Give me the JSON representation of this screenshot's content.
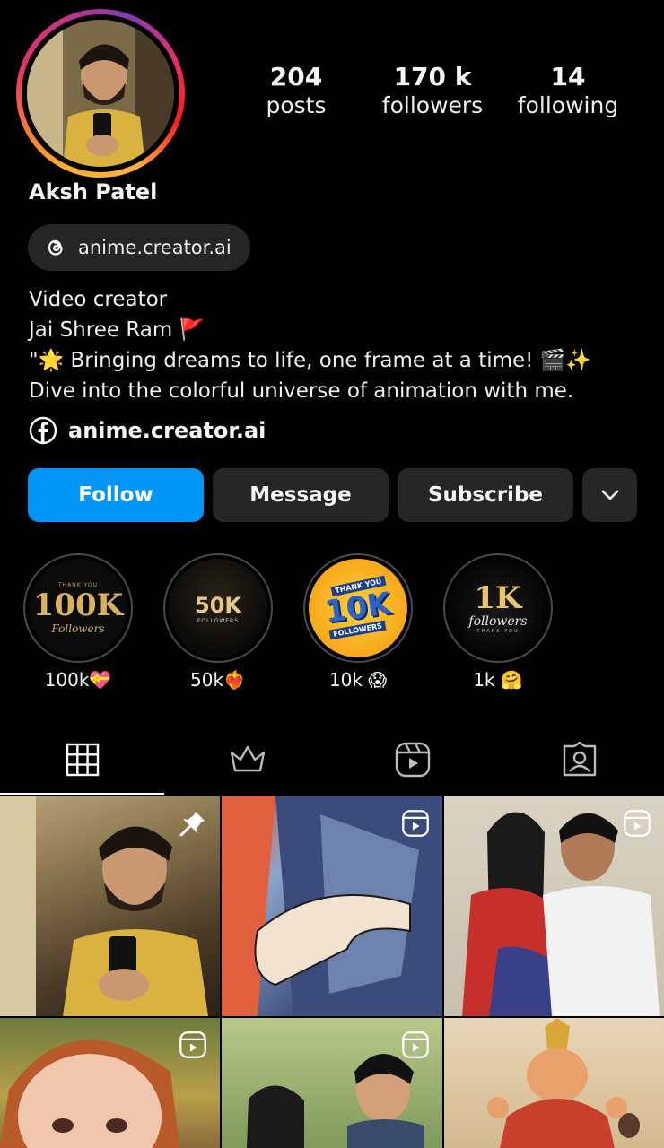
{
  "profile": {
    "name": "Aksh Patel",
    "threads_handle": "anime.creator.ai",
    "facebook_link": "anime.creator.ai"
  },
  "stats": [
    {
      "value": "204",
      "label": "posts"
    },
    {
      "value": "170 k",
      "label": "followers"
    },
    {
      "value": "14",
      "label": "following"
    }
  ],
  "bio": {
    "line1": "Video creator",
    "line2": "Jai Shree Ram 🚩",
    "line3": "\"🌟 Bringing dreams to life, one frame at a time! 🎬✨",
    "line4": "Dive into the colorful universe of animation with me."
  },
  "actions": {
    "follow": "Follow",
    "message": "Message",
    "subscribe": "Subscribe"
  },
  "highlights": [
    {
      "label": "100k💝",
      "badge_big": "100K",
      "badge_small": "Followers",
      "badge_top": "THANK YOU"
    },
    {
      "label": "50k❤️‍🔥",
      "badge_big": "50K",
      "badge_small": "FOLLOWERS"
    },
    {
      "label": "10k 😱",
      "badge_big": "10K",
      "badge_small": "FOLLOWERS",
      "badge_top": "THANK YOU"
    },
    {
      "label": "1k 🤗",
      "badge_big": "1K",
      "badge_small": "followers",
      "badge_top": "THANK YOU"
    }
  ],
  "tabs": [
    "grid-icon",
    "crown-icon",
    "reels-icon",
    "tagged-icon"
  ],
  "colors": {
    "accent": "#0095f6",
    "button_bg": "#262626",
    "background": "#000000"
  },
  "grid": [
    {
      "type": "pinned"
    },
    {
      "type": "reel"
    },
    {
      "type": "reel"
    },
    {
      "type": "reel"
    },
    {
      "type": "reel"
    },
    {
      "type": "post"
    }
  ]
}
